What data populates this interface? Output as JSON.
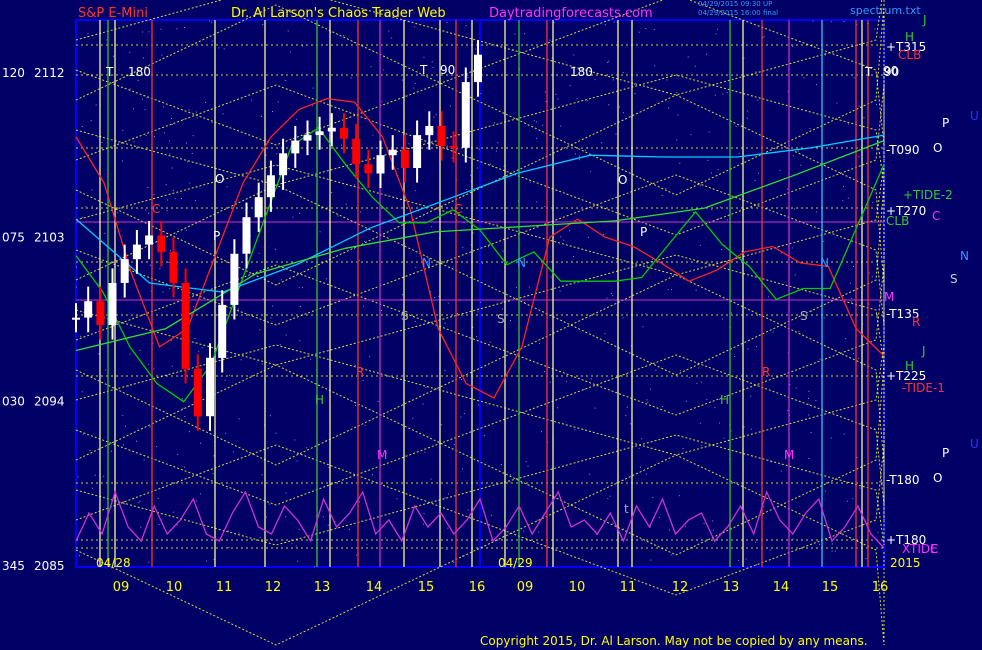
{
  "header": {
    "instrument": "S&P E-Mini",
    "title": "Dr. Al Larson's Chaos Trader Web",
    "site": "Daytradingforecasts.com",
    "stamp_line1": "04/29/2015 09:30 UP",
    "stamp_line2": "04/29/2015 16:00 final",
    "file": "spectrum.txt"
  },
  "footer": {
    "copyright": "Copyright 2015, Dr. Al Larson. May not be copied by any means."
  },
  "colors": {
    "background": "#000066",
    "frame": "#0000ff",
    "price_up": "#ffffff",
    "price_down": "#ff0000",
    "spectrum": "#cc33cc",
    "grid": "#ffff00"
  },
  "chart_data": {
    "type": "candlestick",
    "title": "S&P E-Mini",
    "y_axis": {
      "ticks": [
        {
          "angle": "120",
          "price": "2112",
          "value": 2112
        },
        {
          "angle": "075",
          "price": "2103",
          "value": 2103
        },
        {
          "angle": "030",
          "price": "2094",
          "value": 2094
        },
        {
          "angle": "345",
          "price": "2085",
          "value": 2085
        }
      ],
      "range": [
        2085,
        2112
      ]
    },
    "x_axis": {
      "day1_date": "04/28",
      "day2_date": "04/29",
      "year": "2015",
      "hours": [
        "09",
        "10",
        "11",
        "12",
        "13",
        "14",
        "15",
        "16",
        "09",
        "10",
        "11",
        "12",
        "13",
        "14",
        "15",
        "16"
      ]
    },
    "right_labels": [
      {
        "text": "J",
        "color": "#33cc33"
      },
      {
        "text": "H",
        "color": "#33cc33"
      },
      {
        "text": "+T315",
        "color": "#ffffff"
      },
      {
        "text": "CLB",
        "color": "#ff3333"
      },
      {
        "text": "90",
        "color": "#ffffff"
      },
      {
        "text": "U",
        "color": "#3333ff"
      },
      {
        "text": "P",
        "color": "#ffffff"
      },
      {
        "text": "O",
        "color": "#ffffff"
      },
      {
        "text": "-T090",
        "color": "#ffffff"
      },
      {
        "text": "+TIDE-2",
        "color": "#33cc33"
      },
      {
        "text": "+T270",
        "color": "#ffffff"
      },
      {
        "text": "C",
        "color": "#ff33ff"
      },
      {
        "text": "CLB",
        "color": "#33cc33"
      },
      {
        "text": "N",
        "color": "#3399ff"
      },
      {
        "text": "S",
        "color": "#cccccc"
      },
      {
        "text": "M",
        "color": "#ff33ff"
      },
      {
        "text": "-T135",
        "color": "#ffffff"
      },
      {
        "text": "R",
        "color": "#ff3333"
      },
      {
        "text": "J",
        "color": "#33cc33"
      },
      {
        "text": "H",
        "color": "#33cc33"
      },
      {
        "text": "+T225",
        "color": "#ffffff"
      },
      {
        "text": "-TIDE-1",
        "color": "#ff3333"
      },
      {
        "text": "U",
        "color": "#3333ff"
      },
      {
        "text": "P",
        "color": "#ffffff"
      },
      {
        "text": "O",
        "color": "#ffffff"
      },
      {
        "text": "-T180",
        "color": "#ffffff"
      },
      {
        "text": "+T180",
        "color": "#ffffff"
      },
      {
        "text": "XTIDE",
        "color": "#ff33ff"
      },
      {
        "text": "C",
        "color": "#ff33ff"
      }
    ],
    "in_chart_labels": [
      {
        "text": "T",
        "color": "#ffffff"
      },
      {
        "text": "180",
        "color": "#ffffff"
      },
      {
        "text": "T",
        "color": "#ffffff"
      },
      {
        "text": "90",
        "color": "#ffffff"
      },
      {
        "text": "180",
        "color": "#ffffff"
      },
      {
        "text": "T",
        "color": "#ffffff"
      },
      {
        "text": "90",
        "color": "#ffffff"
      },
      {
        "text": "O",
        "color": "#ffffff"
      },
      {
        "text": "O",
        "color": "#ffffff"
      },
      {
        "text": "P",
        "color": "#ffffff"
      },
      {
        "text": "P",
        "color": "#ffffff"
      },
      {
        "text": "C",
        "color": "#ff3333"
      },
      {
        "text": "C",
        "color": "#ff3333"
      },
      {
        "text": "N",
        "color": "#3399ff"
      },
      {
        "text": "N",
        "color": "#3399ff"
      },
      {
        "text": "N",
        "color": "#3399ff"
      },
      {
        "text": "S",
        "color": "#aaaaaa"
      },
      {
        "text": "S",
        "color": "#aaaaaa"
      },
      {
        "text": "S",
        "color": "#aaaaaa"
      },
      {
        "text": "H",
        "color": "#33cc33"
      },
      {
        "text": "H",
        "color": "#33cc33"
      },
      {
        "text": "M",
        "color": "#ff33ff"
      },
      {
        "text": "M",
        "color": "#ff33ff"
      },
      {
        "text": "R",
        "color": "#ff3333"
      },
      {
        "text": "R",
        "color": "#ff3333"
      },
      {
        "text": "t",
        "color": "#aaaaaa"
      }
    ],
    "price_series": [
      2098.6,
      2099.5,
      2098.2,
      2100.5,
      2101.8,
      2102.6,
      2103.1,
      2102.2,
      2100.5,
      2095.8,
      2093.2,
      2096.4,
      2099.3,
      2102.1,
      2104.1,
      2105.2,
      2106.4,
      2107.6,
      2108.3,
      2108.6,
      2108.8,
      2109.0,
      2108.4,
      2107.0,
      2106.5,
      2107.5,
      2107.8,
      2106.8,
      2108.6,
      2109.1,
      2108.0,
      2107.9,
      2111.5,
      2113.0
    ],
    "price_series_note": "",
    "overlay_series": [
      {
        "color": "#ff2222",
        "values": [
          2108.5,
          2106,
          2101,
          2097,
          2098,
          2102,
          2106,
          2108.5,
          2110,
          2110.6,
          2110.4,
          2108.5,
          2104.5,
          2098,
          2095,
          2094.2,
          2097,
          2103,
          2104,
          2103,
          2102.5,
          2101.6,
          2100.6,
          2101.2,
          2102.2,
          2102.5,
          2101.6,
          2101.4,
          2098,
          2096.5
        ]
      },
      {
        "color": "#00cc00",
        "values": [
          2102,
          2100,
          2097,
          2095,
          2094,
          2096,
          2100,
          2104,
          2108,
          2109,
          2107,
          2105.2,
          2103.8,
          2103.8,
          2104.5,
          2103.4,
          2101.5,
          2102.2,
          2100.6,
          2100.6,
          2100.6,
          2100.8,
          2102.6,
          2104.4,
          2102.6,
          2101.4,
          2099.6,
          2100.2,
          2100.2,
          2103.6,
          2107
        ]
      },
      {
        "color": "#00ccff",
        "values": [
          2104,
          2100.5,
          2100,
          2101.5,
          2103.5,
          2105,
          2106.5,
          2107.5,
          2107.4,
          2107.4,
          2107.9,
          2108.6
        ]
      },
      {
        "color": "#33dd33",
        "values": [
          2096.8,
          2098,
          2101,
          2102.4,
          2103.3,
          2103.6,
          2103.9,
          2104.6,
          2106.4,
          2108.3
        ]
      }
    ],
    "spectrum_series": [
      0.2,
      0.6,
      0.3,
      0.9,
      0.4,
      0.2,
      0.7,
      0.3,
      0.5,
      0.8,
      0.3,
      0.2,
      0.6,
      0.9,
      0.4,
      0.3,
      0.7,
      0.5,
      0.2,
      0.8,
      0.4,
      0.6,
      0.9,
      0.3,
      0.5,
      0.2,
      0.7,
      0.4,
      0.6,
      0.3,
      0.5,
      0.8,
      0.2,
      0.4,
      0.7,
      0.3,
      0.6,
      0.9,
      0.4,
      0.5,
      0.3,
      0.6,
      0.2,
      0.7,
      0.4,
      0.8,
      0.3,
      0.5,
      0.6,
      0.2,
      0.4,
      0.7,
      0.3,
      0.9,
      0.5,
      0.3,
      0.6,
      0.8,
      0.2,
      0.4,
      0.7,
      0.3,
      0.1
    ],
    "grid": true,
    "legend": "none"
  }
}
